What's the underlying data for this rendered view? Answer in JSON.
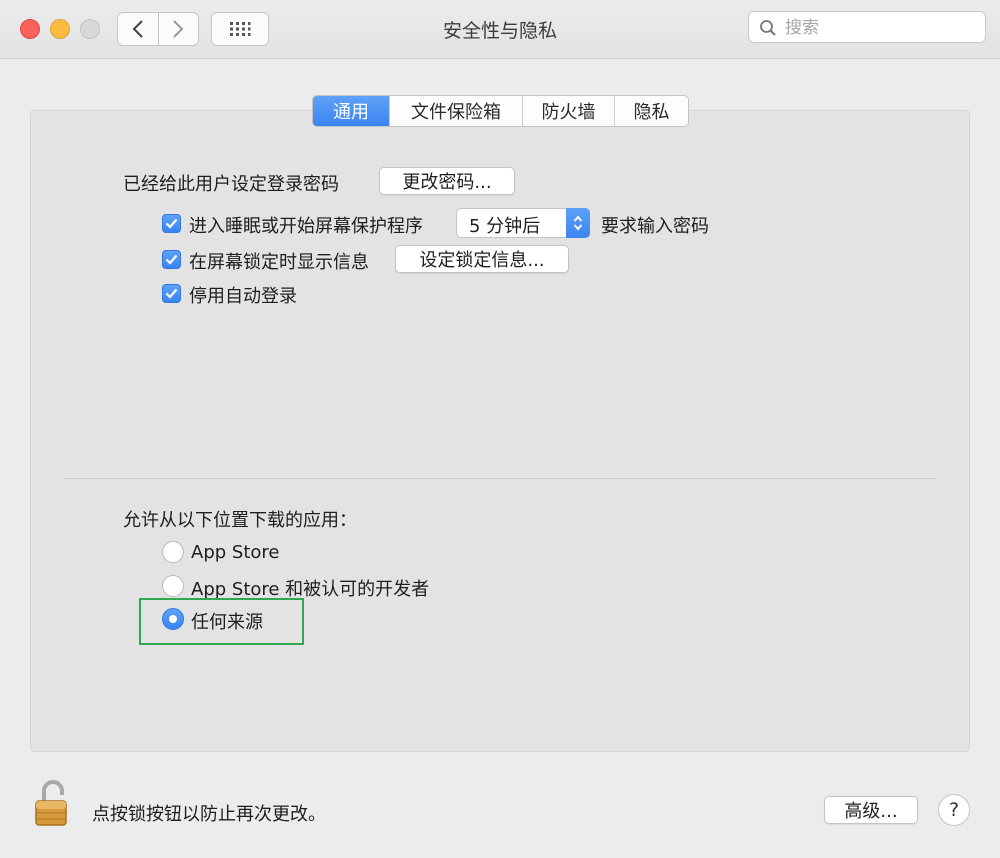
{
  "window": {
    "title": "安全性与隐私",
    "search_placeholder": "搜索"
  },
  "tabs": [
    {
      "label": "通用",
      "active": true
    },
    {
      "label": "文件保险箱",
      "active": false
    },
    {
      "label": "防火墙",
      "active": false
    },
    {
      "label": "隐私",
      "active": false
    }
  ],
  "general": {
    "password_label": "已经给此用户设定登录密码",
    "change_password_button": "更改密码...",
    "require_password": {
      "checked": true,
      "prefix": "进入睡眠或开始屏幕保护程序",
      "delay_value": "5 分钟后",
      "suffix": "要求输入密码"
    },
    "show_message": {
      "checked": true,
      "label": "在屏幕锁定时显示信息",
      "button": "设定锁定信息..."
    },
    "disable_autologin": {
      "checked": true,
      "label": "停用自动登录"
    },
    "downloads_label": "允许从以下位置下载的应用：",
    "download_options": [
      {
        "label": "App Store",
        "selected": false
      },
      {
        "label": "App Store 和被认可的开发者",
        "selected": false
      },
      {
        "label": "任何来源",
        "selected": true
      }
    ]
  },
  "footer": {
    "lock_text": "点按锁按钮以防止再次更改。",
    "advanced_button": "高级...",
    "help_label": "?"
  },
  "colors": {
    "accent": "#3a84f1",
    "highlight_box": "#2fa84f",
    "close": "#fc605c",
    "minimize": "#fdbc40",
    "zoom_disabled": "#d8d8d8"
  }
}
